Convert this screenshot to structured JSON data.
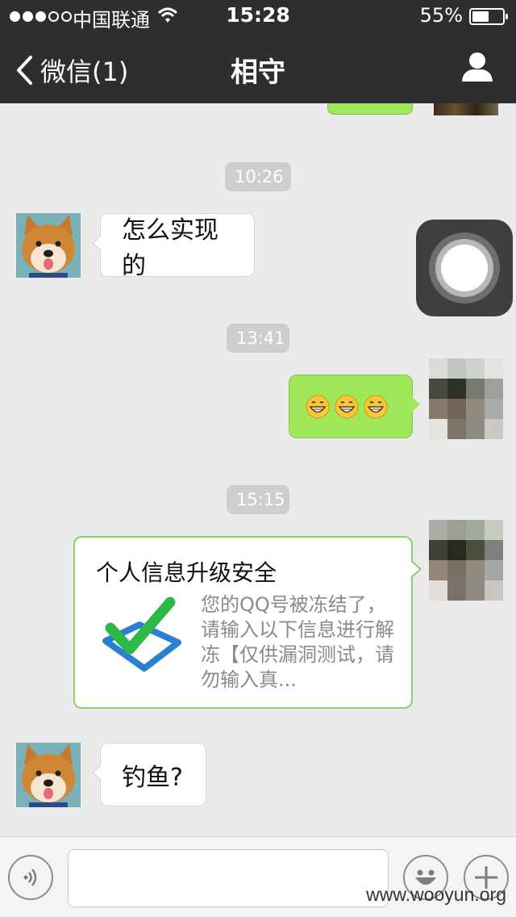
{
  "status_bar": {
    "carrier": "中国联通",
    "time": "15:28",
    "battery": "55%",
    "battery_level": 0.55,
    "signal_bars": 3
  },
  "nav": {
    "back_label": "微信(1)",
    "title": "相守",
    "back_icon": "chevron-left-icon",
    "profile_icon": "person-icon"
  },
  "messages": {
    "time_1": "10:26",
    "msg_1": "怎么实现的",
    "time_2": "13:41",
    "msg_2_emoji_count": 3,
    "time_3": "15:15",
    "card": {
      "title": "个人信息升级安全",
      "description": "您的QQ号被冻结了，请输入以下信息进行解冻【仅供漏洞测试，请勿输入真..."
    },
    "msg_4": "钓鱼?"
  },
  "input_bar": {
    "voice_icon": "voice-icon",
    "emoji_icon": "smiley-icon",
    "plus_icon": "plus-icon"
  },
  "watermark": "www.wooyun.org",
  "colors": {
    "nav_bg": "#2e2e31",
    "chat_bg": "#ebebeb",
    "outgoing_bubble": "#a0e75a",
    "incoming_bubble": "#ffffff",
    "time_badge": "#cecece"
  }
}
